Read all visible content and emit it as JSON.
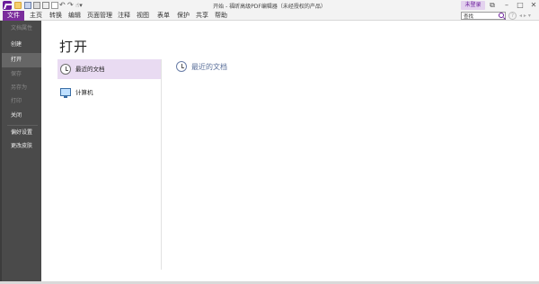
{
  "window": {
    "title": "开始 - 福昕高级PDF编辑器（未经授权的产品）",
    "login_label": "未登录",
    "controls": [
      "restore-icon",
      "minimize-icon",
      "maximize-icon",
      "close-icon"
    ]
  },
  "quick_access": {
    "icons": [
      "open-folder-icon",
      "save-icon",
      "print-icon",
      "email-icon",
      "page-icon",
      "undo-icon",
      "redo-icon",
      "hand-tool-icon"
    ]
  },
  "ribbon": {
    "file_tab": "文件",
    "tabs": [
      "主页",
      "转换",
      "编辑",
      "页面管理",
      "注释",
      "视图",
      "表单",
      "保护",
      "共享",
      "帮助"
    ],
    "search": {
      "value": "查找"
    }
  },
  "sidebar": {
    "items": [
      {
        "label": "文档属性",
        "state": "disabled"
      },
      {
        "label": "创建",
        "state": "normal"
      },
      {
        "label": "打开",
        "state": "active"
      },
      {
        "label": "保存",
        "state": "disabled"
      },
      {
        "label": "另存为",
        "state": "disabled"
      },
      {
        "label": "打印",
        "state": "disabled"
      },
      {
        "label": "关闭",
        "state": "normal"
      },
      {
        "label": "偏好设置",
        "state": "normal"
      },
      {
        "label": "更改皮肤",
        "state": "normal"
      }
    ]
  },
  "main": {
    "page_title": "打开",
    "locations": [
      {
        "label": "最近的文档",
        "icon": "clock-icon",
        "selected": true
      },
      {
        "label": "计算机",
        "icon": "computer-icon",
        "selected": false
      }
    ],
    "panel_heading": "最近的文档"
  },
  "colors": {
    "accent": "#7b2d9c",
    "sidebar_bg": "#4a4a4a",
    "sidebar_active": "#666666",
    "selected_row": "#e9dbf2",
    "heading_blue": "#5a6f9a"
  }
}
